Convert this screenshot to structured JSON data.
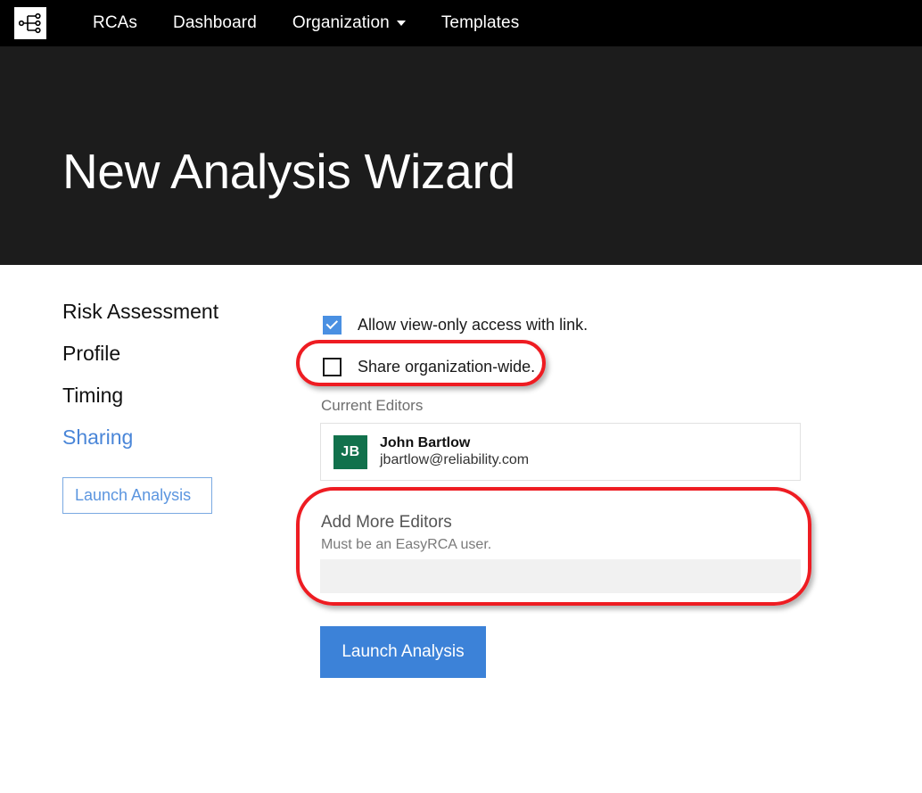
{
  "nav": {
    "logo_icon": "hierarchy-tree-icon",
    "links": [
      {
        "label": "RCAs",
        "caret": false
      },
      {
        "label": "Dashboard",
        "caret": false
      },
      {
        "label": "Organization",
        "caret": true
      },
      {
        "label": "Templates",
        "caret": false
      }
    ]
  },
  "hero": {
    "title": "New Analysis Wizard"
  },
  "sidebar": {
    "steps": [
      {
        "label": "Risk Assessment",
        "active": false
      },
      {
        "label": "Profile",
        "active": false
      },
      {
        "label": "Timing",
        "active": false
      },
      {
        "label": "Sharing",
        "active": true
      }
    ],
    "launch_button": "Launch Analysis"
  },
  "main": {
    "checkboxes": [
      {
        "label": "Allow view-only access with link.",
        "checked": true
      },
      {
        "label": "Share organization-wide.",
        "checked": false
      }
    ],
    "current_editors_label": "Current Editors",
    "editors": [
      {
        "initials": "JB",
        "name": "John Bartlow",
        "email": "jbartlow@reliability.com",
        "avatar_color": "#11714c"
      }
    ],
    "add_editors": {
      "title": "Add More Editors",
      "subtitle": "Must be an EasyRCA user.",
      "input_value": "",
      "input_placeholder": ""
    },
    "launch_button": "Launch Analysis"
  },
  "annotations": [
    {
      "name": "share-organization-wide-highlight",
      "color": "#ee1c22"
    },
    {
      "name": "add-more-editors-highlight",
      "color": "#ee1c22"
    }
  ],
  "colors": {
    "nav_background": "#000000",
    "hero_background": "#1c1c1c",
    "accent_blue": "#3c82d8",
    "link_blue": "#4a86d8",
    "checkbox_blue": "#4a90e2",
    "avatar_green": "#11714c",
    "annotation_red": "#ee1c22",
    "input_gray": "#f1f1f1"
  }
}
